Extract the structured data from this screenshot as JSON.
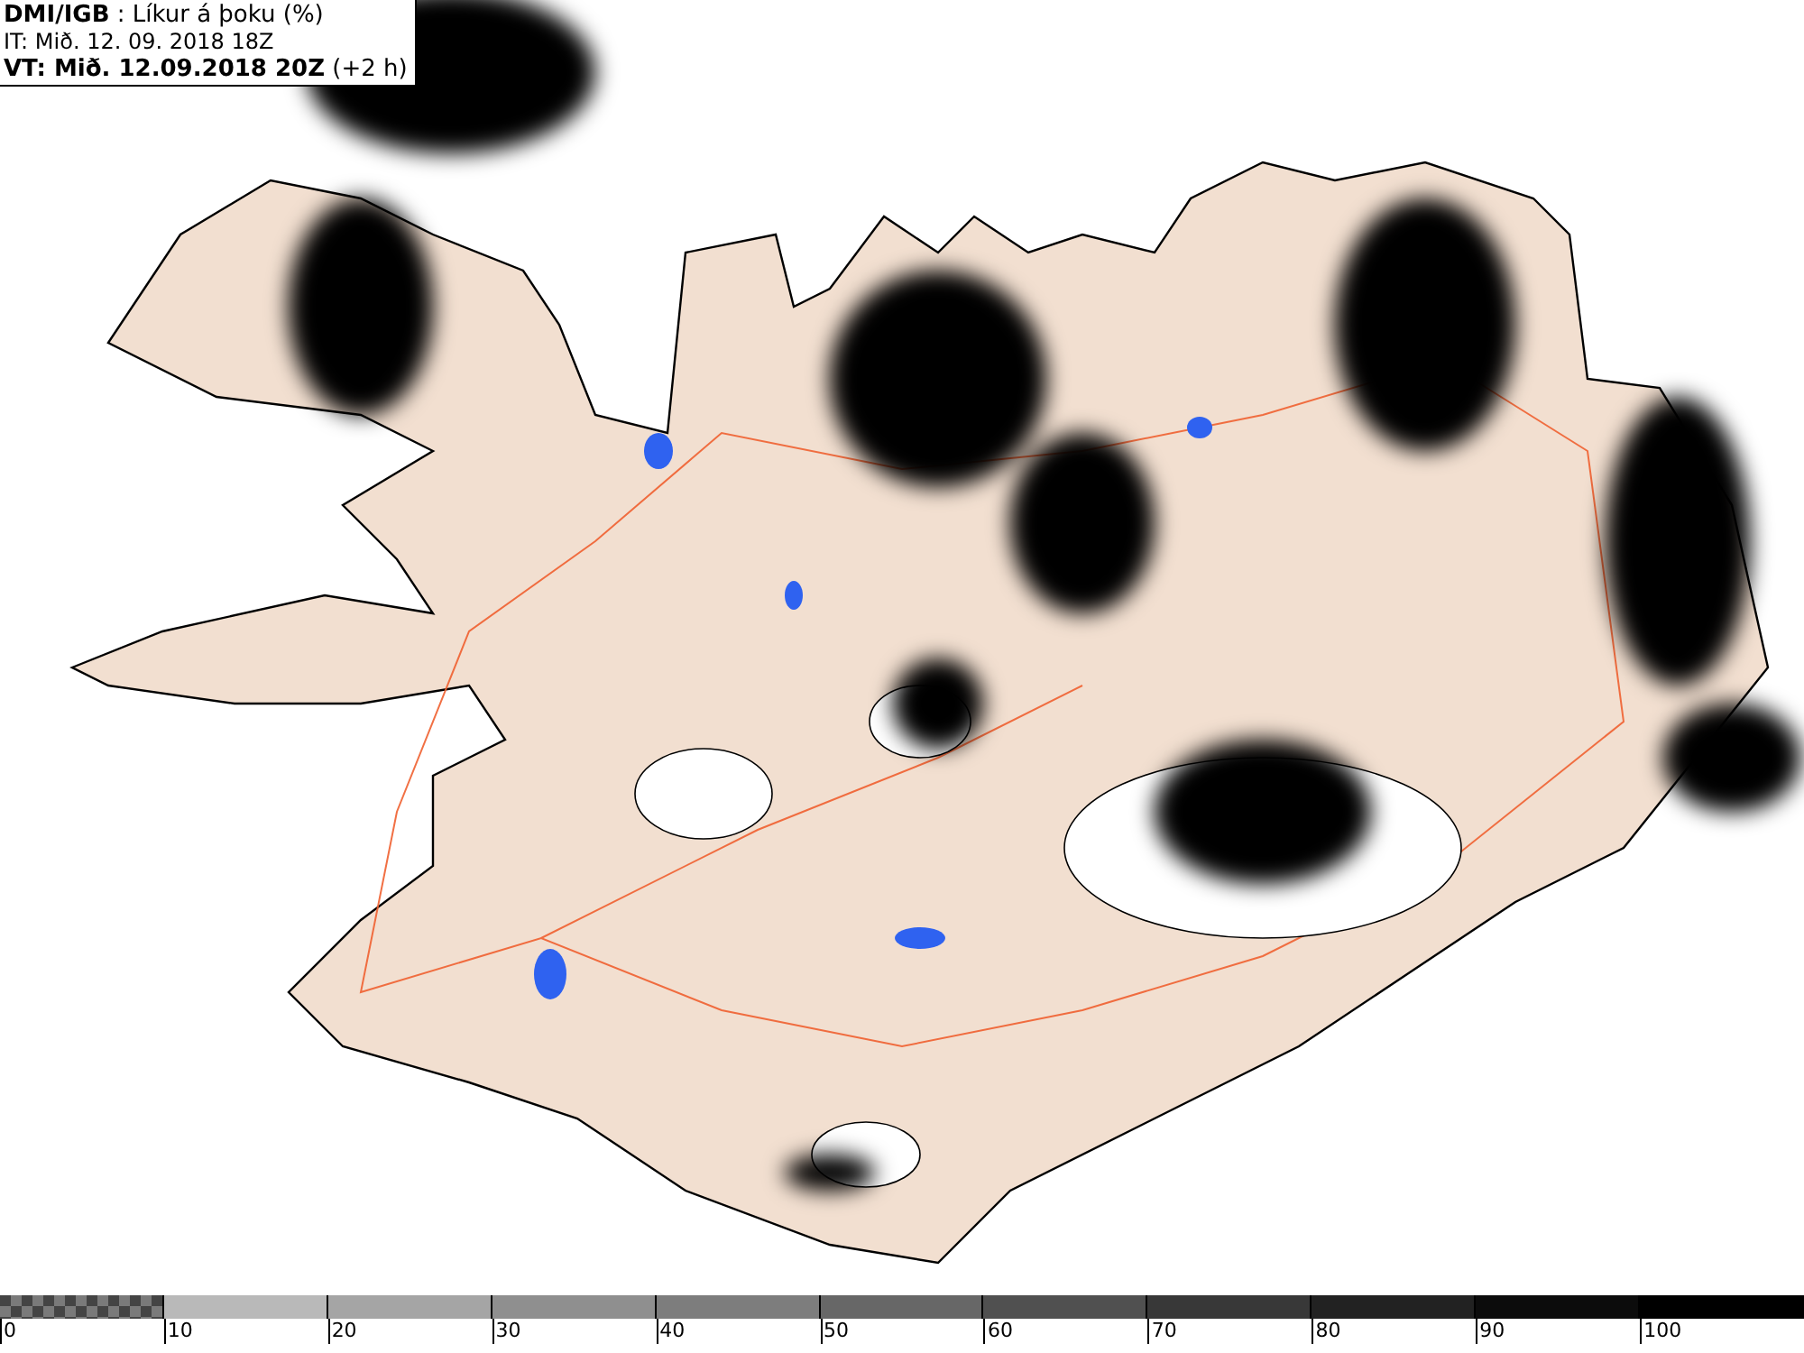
{
  "header": {
    "title": "**DMI/IGB** : Líkur á þoku (%)",
    "issue_time": "IT: Mið. 12. 09. 2018 18Z",
    "valid_time": "**VT: Mið. 12.09.2018 20Z** (+2 h)"
  },
  "legend": {
    "bins": [
      {
        "kind": "checkered",
        "color": "#7a7a7a"
      },
      {
        "kind": "solid",
        "color": "#b9b9b9"
      },
      {
        "kind": "solid",
        "color": "#a5a5a5"
      },
      {
        "kind": "solid",
        "color": "#8f8f8f"
      },
      {
        "kind": "solid",
        "color": "#7d7d7d"
      },
      {
        "kind": "solid",
        "color": "#676767"
      },
      {
        "kind": "solid",
        "color": "#505050"
      },
      {
        "kind": "solid",
        "color": "#383838"
      },
      {
        "kind": "solid",
        "color": "#222222"
      },
      {
        "kind": "solid",
        "color": "#0c0c0c"
      },
      {
        "kind": "solid",
        "color": "#000000"
      }
    ],
    "labels": [
      "0",
      "10",
      "20",
      "30",
      "40",
      "50",
      "60",
      "70",
      "80",
      "90",
      "100"
    ]
  }
}
